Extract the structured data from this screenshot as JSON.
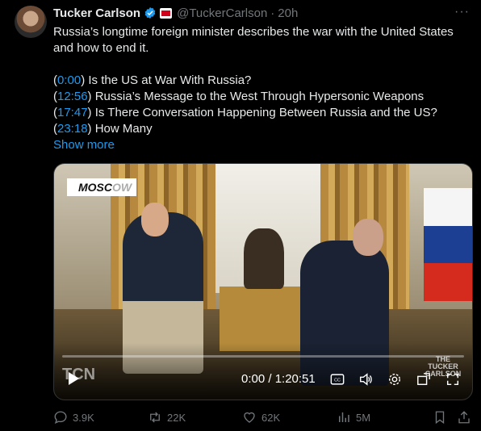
{
  "author": {
    "name": "Tucker Carlson",
    "handle": "@TuckerCarlson",
    "separator": "·",
    "time": "20h"
  },
  "menu": {
    "more_label": "···"
  },
  "tweet": {
    "intro": "Russia’s longtime foreign minister describes the war with the United States and how to end it.",
    "chapters": [
      {
        "timestamp": "0:00",
        "text": "Is the US at War With Russia?"
      },
      {
        "timestamp": "12:56",
        "text": "Russia’s Message to the West Through Hypersonic Weapons"
      },
      {
        "timestamp": "17:47",
        "text": "Is There Conversation Happening Between Russia and the US?"
      },
      {
        "timestamp": "23:18",
        "text": "How Many"
      }
    ],
    "show_more": "Show more"
  },
  "video": {
    "overlay_label": "MOSC",
    "overlay_label_faded": "OW",
    "watermark": "TCN",
    "brand_line1": "THE",
    "brand_line2": "TUCKER",
    "brand_line3": "CARLSON",
    "time_display": "0:00 / 1:20:51",
    "progress": 0.0
  },
  "actions": {
    "replies": "3.9K",
    "reposts": "22K",
    "likes": "62K",
    "views": "5M"
  },
  "colors": {
    "accent": "#1d9bf0",
    "muted": "#71767b",
    "text": "#e7e9ea",
    "background": "#000000"
  },
  "icons": {
    "verified": "verified-badge-icon",
    "affiliate": "state-media-affiliate-icon",
    "more": "more-icon",
    "play": "play-icon",
    "cc": "closed-captions-icon",
    "volume": "volume-icon",
    "settings": "settings-gear-icon",
    "pip": "picture-in-picture-icon",
    "fullscreen": "fullscreen-icon",
    "reply": "reply-icon",
    "repost": "repost-icon",
    "like": "heart-icon",
    "views": "views-icon",
    "bookmark": "bookmark-icon",
    "share": "share-icon"
  }
}
